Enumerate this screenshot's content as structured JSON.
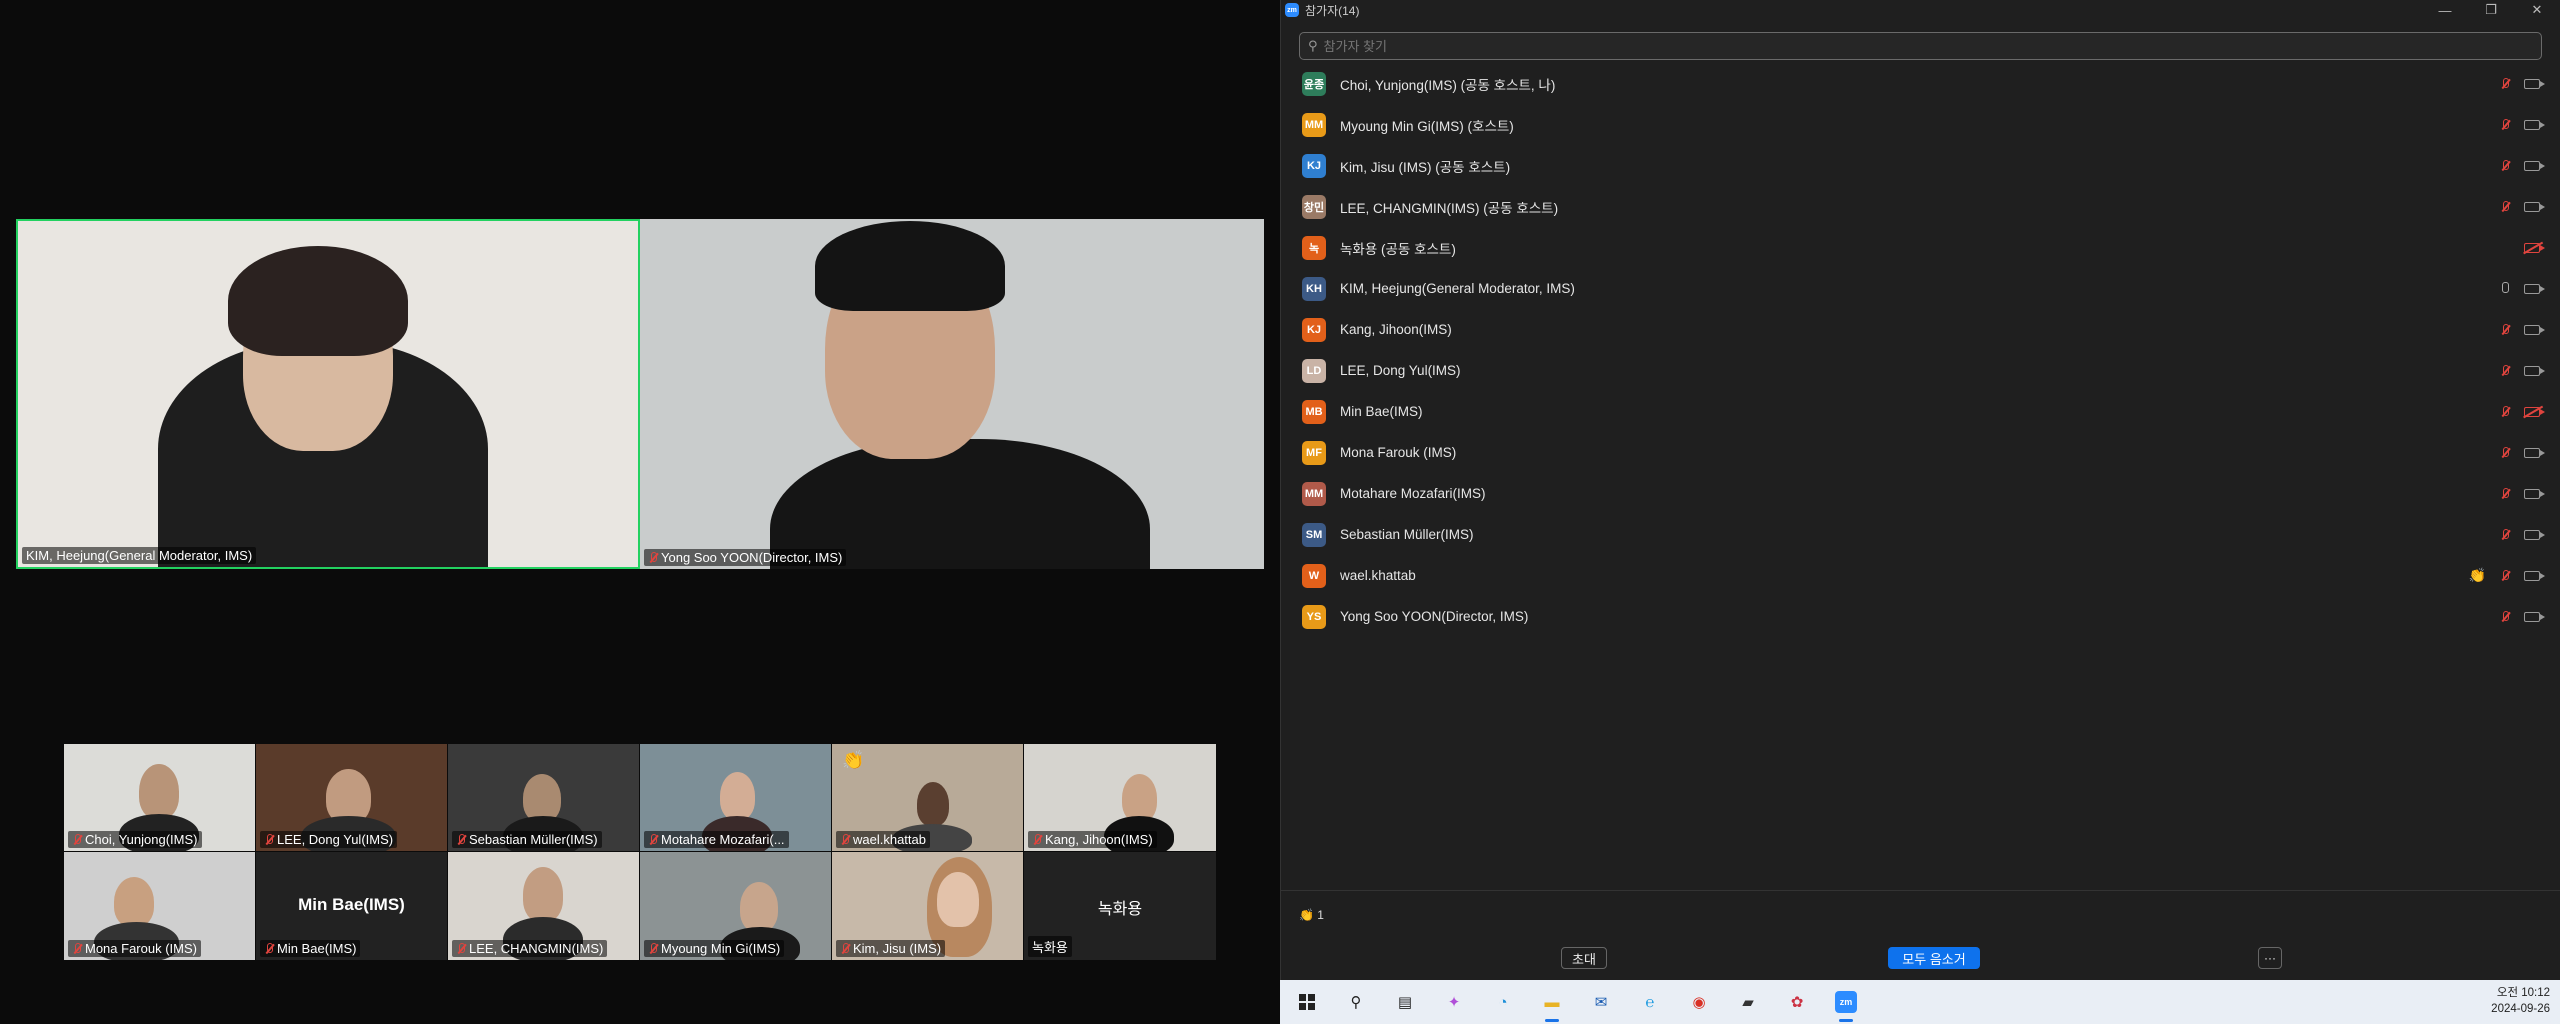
{
  "meeting": {
    "main_tiles": [
      {
        "name": "KIM, Heejung(General Moderator, IMS)",
        "muted": false
      },
      {
        "name": "Yong Soo YOON(Director, IMS)",
        "muted": true
      }
    ],
    "gallery": [
      {
        "name": "Choi, Yunjong(IMS)"
      },
      {
        "name": "LEE, Dong Yul(IMS)"
      },
      {
        "name": "Sebastian Müller(IMS)"
      },
      {
        "name": "Motahare Mozafari(..."
      },
      {
        "name": "wael.khattab",
        "reaction": "👏"
      },
      {
        "name": "Kang, Jihoon(IMS)"
      },
      {
        "name": "Mona Farouk (IMS)"
      },
      {
        "name": "Min Bae(IMS)",
        "center": "Min Bae(IMS)"
      },
      {
        "name": "LEE, CHANGMIN(IMS)"
      },
      {
        "name": "Myoung Min Gi(IMS)"
      },
      {
        "name": "Kim, Jisu (IMS)"
      },
      {
        "name": "녹화용",
        "center": "녹화용"
      }
    ]
  },
  "panel": {
    "title": "참가자(14)",
    "search_placeholder": "참가자 찾기",
    "participants": [
      {
        "avatar": "윤종",
        "color": "#2e7d5b",
        "name": "Choi, Yunjong(IMS) (공동 호스트, 나)"
      },
      {
        "avatar": "MM",
        "color": "#e89a18",
        "name": "Myoung Min Gi(IMS) (호스트)"
      },
      {
        "avatar": "KJ",
        "color": "#2f7fd0",
        "name": "Kim, Jisu (IMS) (공동 호스트)"
      },
      {
        "avatar": "창민",
        "color": "#9a7a66",
        "name": "LEE, CHANGMIN(IMS) (공동 호스트)"
      },
      {
        "avatar": "녹",
        "color": "#e2601a",
        "name": "녹화용 (공동 호스트)"
      },
      {
        "avatar": "KH",
        "color": "#3c5a86",
        "name": "KIM, Heejung(General Moderator, IMS)"
      },
      {
        "avatar": "KJ",
        "color": "#e2601a",
        "name": "Kang, Jihoon(IMS)"
      },
      {
        "avatar": "LD",
        "color": "#c9b3a6",
        "name": "LEE, Dong Yul(IMS)"
      },
      {
        "avatar": "MB",
        "color": "#e2601a",
        "name": "Min Bae(IMS)"
      },
      {
        "avatar": "MF",
        "color": "#e89a18",
        "name": "Mona Farouk (IMS)"
      },
      {
        "avatar": "MM",
        "color": "#b05a4a",
        "name": "Motahare Mozafari(IMS)"
      },
      {
        "avatar": "SM",
        "color": "#3c5a86",
        "name": "Sebastian Müller(IMS)"
      },
      {
        "avatar": "W",
        "color": "#e2601a",
        "name": "wael.khattab"
      },
      {
        "avatar": "YS",
        "color": "#e89a18",
        "name": "Yong Soo YOON(Director, IMS)"
      }
    ],
    "reaction_count": "👏 1",
    "invite_label": "초대",
    "mute_all_label": "모두 음소거",
    "more_label": "···"
  },
  "taskbar": {
    "time": "오전 10:12",
    "date": "2024-09-26"
  }
}
